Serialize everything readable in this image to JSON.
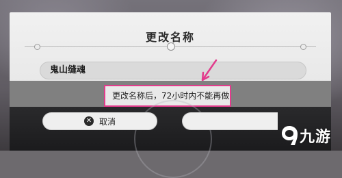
{
  "dialog": {
    "title": "更改名称",
    "name_value": "鬼山缝魂",
    "warning": "更改名称后，72小时内不能再做",
    "cancel_label": "取消",
    "cancel_icon": "close-icon",
    "confirm_label": ""
  },
  "overlay": {
    "highlight_color": "#e23b8c"
  },
  "watermark": {
    "icon": "九游-logo",
    "text": "九游"
  }
}
